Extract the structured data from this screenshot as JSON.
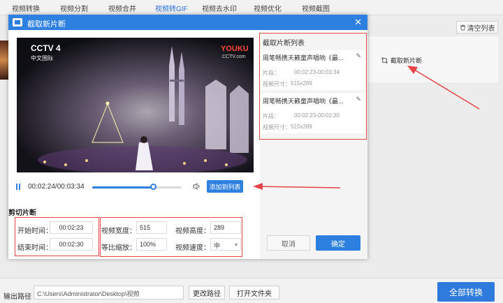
{
  "top_tabs": [
    "视频转换",
    "视频分割",
    "视频合并",
    "视频转GIF",
    "视频去水印",
    "视频优化",
    "视频截图"
  ],
  "active_tab_index": 3,
  "background": {
    "clear_list": "清空列表",
    "crop_label": "截取新片断"
  },
  "dialog": {
    "title": "截取新片断",
    "close": "✕"
  },
  "video": {
    "channel_logo": "CCTV 4",
    "channel_sub": "中文国际",
    "corner_logo": "YOUKU",
    "corner_logo_sub": "CCTV.com"
  },
  "player": {
    "time": "00:02:24/00:03:34",
    "progress": 0.68,
    "add_to_list": "添加到列表"
  },
  "clip": {
    "section_title": "剪切片断",
    "start_label": "开始时间：",
    "start_value": "00:02:23",
    "end_label": "结束时间：",
    "end_value": "00:02:30",
    "width_label": "视频宽度：",
    "width_value": "515",
    "height_label": "视频高度：",
    "height_value": "289",
    "scale_label": "等比缩放：",
    "scale_value": "100%",
    "speed_label": "视频速度：",
    "speed_value": "中"
  },
  "list": {
    "title": "截取片断列表",
    "items": [
      {
        "name": "周笔畅携天籁童声唱响《最...",
        "segment_label": "片段：",
        "segment_value": "00:02:23-00:03:34",
        "size_label": "视频尺寸：",
        "size_value": "515x289"
      },
      {
        "name": "周笔畅携天籁童声唱响《最...",
        "segment_label": "片段：",
        "segment_value": "00:02:23-00:02:30",
        "size_label": "视频尺寸：",
        "size_value": "515x289"
      }
    ]
  },
  "actions": {
    "cancel": "取消",
    "ok": "确定"
  },
  "bottom": {
    "output_label": "输出路径",
    "output_path": "C:\\Users\\Administrator\\Desktop\\视频",
    "change_path": "更改路径",
    "open_folder": "打开文件夹",
    "convert_all": "全部转换"
  },
  "colors": {
    "accent": "#2d7fe0",
    "annotation": "#e64545"
  }
}
